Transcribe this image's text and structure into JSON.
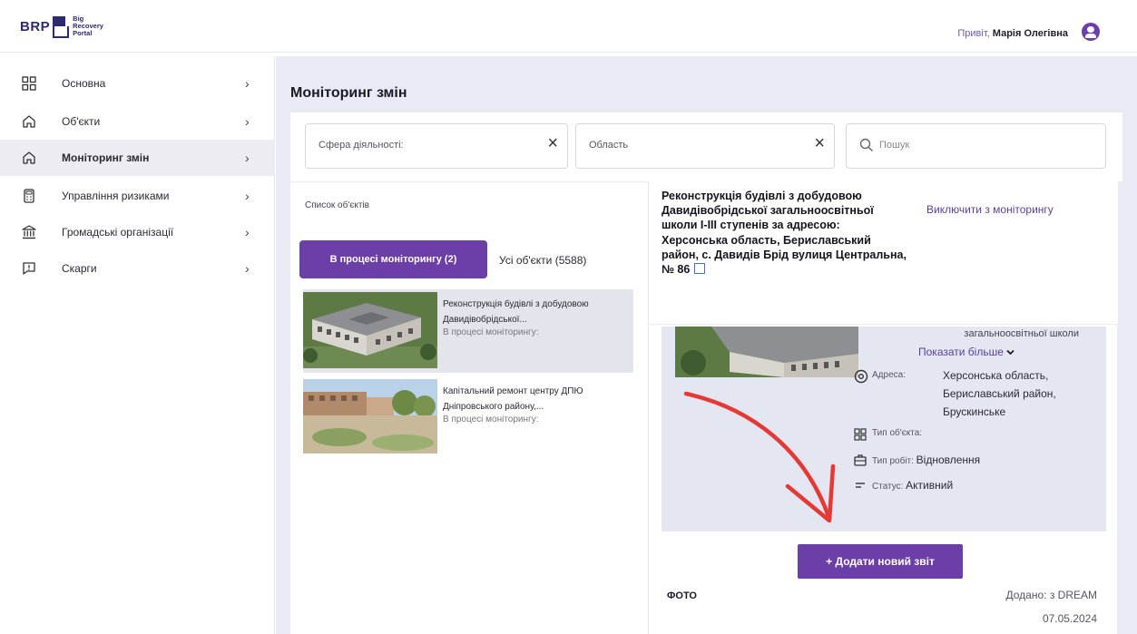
{
  "header": {
    "logo_abbr": "BRP",
    "logo_line1": "Big",
    "logo_line2": "Recovery",
    "logo_line3": "Portal",
    "greeting": "Привіт,",
    "user_name": "Марія Олегівна"
  },
  "sidebar": {
    "items": [
      {
        "label": "Основна",
        "icon": "grid-icon"
      },
      {
        "label": "Об'єкти",
        "icon": "home-icon"
      },
      {
        "label": "Моніторинг змін",
        "icon": "home-icon",
        "active": true
      },
      {
        "label": "Управління ризиками",
        "icon": "calculator-icon"
      },
      {
        "label": "Громадські організації",
        "icon": "bank-icon"
      },
      {
        "label": "Скарги",
        "icon": "alert-message-icon"
      }
    ]
  },
  "main": {
    "title": "Моніторинг змін",
    "filters": {
      "sphere": "Сфера діяльності:",
      "region": "Область",
      "search_placeholder": "Пошук"
    },
    "list": {
      "heading": "Список об'єктів",
      "tab_active": "В процесі моніторингу (2)",
      "tab_all": "Усі об'єкти (5588)",
      "items": [
        {
          "title": "Реконструкція будівлі з добудовою Давидівобрідської...",
          "status": "В процесі моніторингу:"
        },
        {
          "title": "Капітальний ремонт центру ДПЮ Дніпровського району,...",
          "status": "В процесі моніторингу:"
        }
      ]
    },
    "detail": {
      "title": "Реконструкція будівлі з добудовою Давидівобрідської загальноосвітньої школи І-ІІІ ступенів за адресою: Херсонська область, Бериславський район, с. Давидів Брід вулиця Центральна, № 86",
      "exclude": "Виключити з моніторингу",
      "excerpt": "загальноосвітньої школи",
      "show_more": "Показати більше",
      "address_label": "Адреса:",
      "address_value": "Херсонська область, Бериславський район, Брускинське",
      "object_type_label": "Тип об'єкта:",
      "work_type_label": "Тип робіт:",
      "work_type_value": "Відновлення",
      "status_label": "Статус:",
      "status_value": "Активний",
      "add_report": "+ Додати новий звіт",
      "photo_label": "ФОТО",
      "added_by": "Додано: з DREAM",
      "added_date": "07.05.2024"
    }
  },
  "colors": {
    "accent": "#6c3fa8",
    "link": "#5a3fa0",
    "main_bg": "#e8ebf3",
    "arrow": "#e53935"
  }
}
